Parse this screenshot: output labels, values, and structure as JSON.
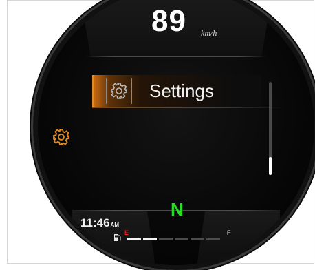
{
  "speedometer": {
    "speed": "89",
    "unit": "km/h"
  },
  "menu": {
    "selected_item_label": "Settings",
    "selected_item_icon": "gear-icon",
    "side_icon": "gear-icon"
  },
  "status": {
    "time": "11:46",
    "ampm": "AM",
    "gear": "N"
  },
  "fuel": {
    "empty_label": "E",
    "full_label": "F",
    "segments_total": 6,
    "segments_filled": 2
  },
  "colors": {
    "accent": "#e38a25",
    "gear_green": "#24e024",
    "fuel_empty_red": "#e02020"
  },
  "scrollbar": {
    "position_fraction": 0.95
  }
}
